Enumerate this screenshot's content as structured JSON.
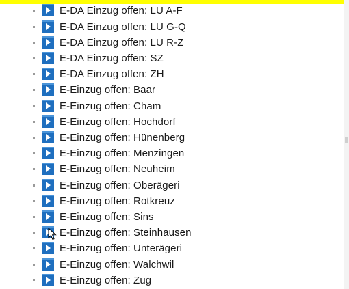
{
  "tree": {
    "items": [
      {
        "label": "E-DA Einzug offen: LU A-F"
      },
      {
        "label": "E-DA Einzug offen: LU G-Q"
      },
      {
        "label": "E-DA Einzug offen: LU R-Z"
      },
      {
        "label": "E-DA Einzug offen: SZ"
      },
      {
        "label": "E-DA Einzug offen: ZH"
      },
      {
        "label": "E-Einzug offen: Baar"
      },
      {
        "label": "E-Einzug offen: Cham"
      },
      {
        "label": "E-Einzug offen: Hochdorf"
      },
      {
        "label": "E-Einzug offen: Hünenberg"
      },
      {
        "label": "E-Einzug offen: Menzingen"
      },
      {
        "label": "E-Einzug offen: Neuheim"
      },
      {
        "label": "E-Einzug offen: Oberägeri"
      },
      {
        "label": "E-Einzug offen: Rotkreuz"
      },
      {
        "label": "E-Einzug offen: Sins"
      },
      {
        "label": "E-Einzug offen: Steinhausen"
      },
      {
        "label": "E-Einzug offen: Unterägeri"
      },
      {
        "label": "E-Einzug offen: Walchwil"
      },
      {
        "label": "E-Einzug offen: Zug"
      }
    ],
    "item_icon": "blue-play-report-icon",
    "hovered_index": 14
  },
  "colors": {
    "icon_blue": "#1f6fbf",
    "highlight": "#ffff00"
  }
}
